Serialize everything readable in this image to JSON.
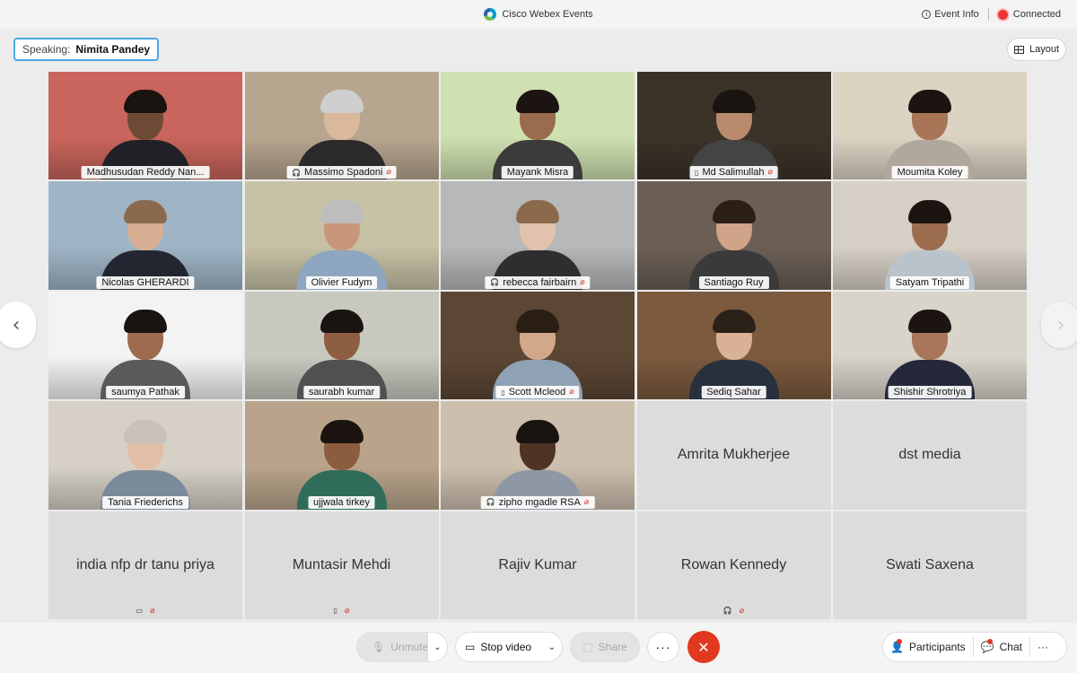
{
  "window": {
    "title": "Cisco Webex Events",
    "event_info": "Event Info",
    "status": "Connected"
  },
  "speaking": {
    "label": "Speaking:",
    "name": "Nimita Pandey"
  },
  "layout_label": "Layout",
  "nav": {
    "prev_icon": "‹",
    "next_icon": "›"
  },
  "participants": [
    {
      "name": "Madhusudan Reddy Nan...",
      "video": true,
      "bg": "#c9655c",
      "skin": "#6e4a36",
      "hair": "#1a1410",
      "shirt": "#1f2126"
    },
    {
      "name": "Massimo Spadoni",
      "video": true,
      "mic_off": true,
      "device": "headset-icon",
      "bg": "#b7a68f",
      "skin": "#d9b89c",
      "hair": "#cfcfcf",
      "shirt": "#2a2a2a"
    },
    {
      "name": "Mayank Misra",
      "video": true,
      "bg": "#cfe1b0",
      "skin": "#9a6b4c",
      "hair": "#1b1410",
      "shirt": "#3b3b3b"
    },
    {
      "name": "Md Salimullah",
      "video": true,
      "mic_off": true,
      "device": "phone-icon",
      "bg": "#3b3328",
      "skin": "#b98a6c",
      "hair": "#1a1410",
      "shirt": "#444"
    },
    {
      "name": "Moumita Koley",
      "video": true,
      "bg": "#dcd3c3",
      "skin": "#a87556",
      "hair": "#1b1410",
      "shirt": "#b0a89c"
    },
    {
      "name": "Nicolas GHERARDI",
      "video": true,
      "bg": "#9fb5c6",
      "skin": "#d8ae92",
      "hair": "#8a6a4f",
      "shirt": "#232631"
    },
    {
      "name": "Olivier Fudym",
      "video": true,
      "bg": "#c7c2a6",
      "skin": "#c8977a",
      "hair": "#bdbdbd",
      "shirt": "#8fa6c0"
    },
    {
      "name": "rebecca fairbairn",
      "video": true,
      "mic_off": true,
      "device": "headset-icon",
      "bg": "#b7b8b9",
      "skin": "#e3c2ad",
      "hair": "#8b6a4c",
      "shirt": "#2e2e2e"
    },
    {
      "name": "Santiago Ruy",
      "video": true,
      "bg": "#6b5f55",
      "skin": "#d0a488",
      "hair": "#2a1e15",
      "shirt": "#3a3a3a"
    },
    {
      "name": "Satyam Tripathi",
      "video": true,
      "bg": "#d7d0c7",
      "skin": "#9c6c4f",
      "hair": "#1b1410",
      "shirt": "#b9c3cc"
    },
    {
      "name": "saumya Pathak",
      "video": true,
      "bg": "#f3f3f3",
      "skin": "#9e6b4f",
      "hair": "#1a1410",
      "shirt": "#5a5a5a"
    },
    {
      "name": "saurabh kumar",
      "video": true,
      "bg": "#c7c9bf",
      "skin": "#8e5e42",
      "hair": "#1a1410",
      "shirt": "#505050"
    },
    {
      "name": "Scott Mcleod",
      "video": true,
      "mic_off": true,
      "device": "phone-icon",
      "bg": "#5c4634",
      "skin": "#d2a88b",
      "hair": "#2a1e15",
      "shirt": "#8fa2b5"
    },
    {
      "name": "Sediq Sahar",
      "video": true,
      "bg": "#7c5a3e",
      "skin": "#d8b196",
      "hair": "#2b2119",
      "shirt": "#28303d"
    },
    {
      "name": "Shishir Shrotriya",
      "video": true,
      "bg": "#d9d4ca",
      "skin": "#a87658",
      "hair": "#1b1410",
      "shirt": "#24283a"
    },
    {
      "name": "Tania Friederichs",
      "video": true,
      "bg": "#d6d0c6",
      "skin": "#e0bfa6",
      "hair": "#c8c2b8",
      "shirt": "#7b8a9a"
    },
    {
      "name": "ujjwala tirkey",
      "video": true,
      "bg": "#b9a48b",
      "skin": "#8c5c40",
      "hair": "#1b1410",
      "shirt": "#2f6d5a"
    },
    {
      "name": "zipho mgadle RSA",
      "video": true,
      "mic_off": true,
      "device": "headset-icon",
      "bg": "#cdbfae",
      "skin": "#4f3325",
      "hair": "#1a1410",
      "shirt": "#8e98a4"
    },
    {
      "name": "Amrita Mukherjee",
      "video": false
    },
    {
      "name": "dst media",
      "video": false
    },
    {
      "name": "india nfp dr tanu priya",
      "video": false,
      "mic_off": true,
      "device": "screen-icon"
    },
    {
      "name": "Muntasir Mehdi",
      "video": false,
      "mic_off": true,
      "device": "phone-icon"
    },
    {
      "name": "Rajiv Kumar",
      "video": false
    },
    {
      "name": "Rowan Kennedy",
      "video": false,
      "mic_off": true,
      "device": "headset-icon"
    },
    {
      "name": "Swati Saxena",
      "video": false
    }
  ],
  "controls": {
    "unmute": "Unmute",
    "stop_video": "Stop video",
    "share": "Share",
    "more": "···",
    "leave_icon": "✕",
    "participants": "Participants",
    "chat": "Chat",
    "overflow": "···"
  },
  "icons": {
    "mic_icon": "🎙",
    "video_icon": "▭",
    "share_icon": "⬚",
    "people_icon": "👤",
    "chat_icon": "💬"
  },
  "colors": {
    "accent": "#49a9e8",
    "leave": "#e0391f",
    "mic_off": "#d93025"
  }
}
